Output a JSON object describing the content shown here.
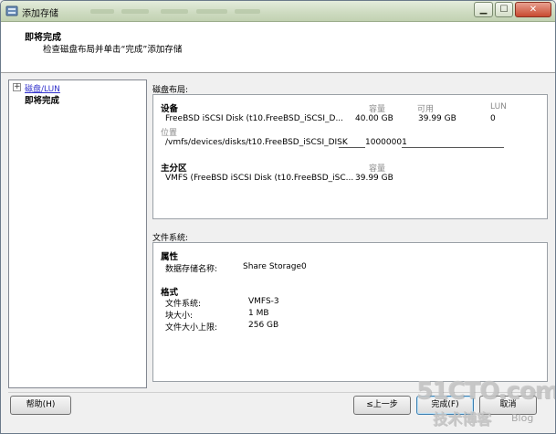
{
  "window": {
    "title": "添加存储",
    "min_symbol": "▁",
    "max_symbol": "☐",
    "close_symbol": "✕"
  },
  "header": {
    "title": "即将完成",
    "subtitle": "检查磁盘布局并单击“完成”添加存储"
  },
  "nav": {
    "expander": "+",
    "items": [
      {
        "label": "磁盘/LUN",
        "state": "link"
      },
      {
        "label": "即将完成",
        "state": "current"
      }
    ]
  },
  "disk_layout": {
    "label": "磁盘布局:",
    "device": {
      "heading": "设备",
      "col_capacity": "容量",
      "col_available": "可用",
      "col_lun": "LUN",
      "name": "FreeBSD iSCSI Disk (t10.FreeBSD_iSCSI_D...",
      "capacity": "40.00 GB",
      "available": "39.99 GB",
      "lun": "0",
      "location_label": "位置",
      "location_path": "/vmfs/devices/disks/t10.FreeBSD_iSCSI_DISK",
      "location_suffix": "10000001"
    },
    "primary_partition": {
      "heading": "主分区",
      "col_capacity": "容量",
      "name": "VMFS (FreeBSD iSCSI Disk (t10.FreeBSD_iSC...",
      "capacity": "39.99 GB"
    }
  },
  "file_system": {
    "label": "文件系统:",
    "properties_heading": "属性",
    "datastore_name_label": "数据存储名称:",
    "datastore_name_value": "Share Storage0",
    "format_heading": "格式",
    "fs_label": "文件系统:",
    "fs_value": "VMFS-3",
    "block_size_label": "块大小:",
    "block_size_value": "1 MB",
    "max_file_size_label": "文件大小上限:",
    "max_file_size_value": "256 GB"
  },
  "buttons": {
    "help": "帮助(H)",
    "back": "≤上一步",
    "finish": "完成(F)",
    "cancel": "取消"
  },
  "watermark": {
    "main": "51CTO.com",
    "sub": "技术博客",
    "blog": "Blog"
  }
}
